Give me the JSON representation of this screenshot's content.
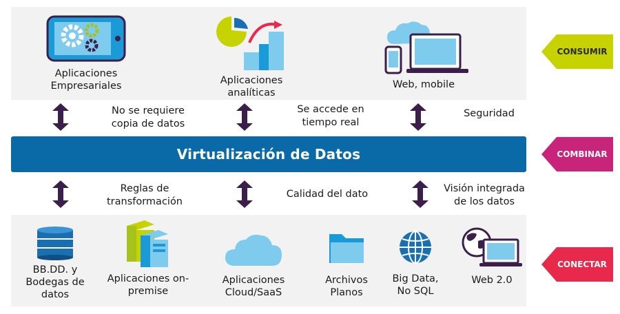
{
  "consumer_apps": [
    {
      "label": "Aplicaciones\nEmpresariales",
      "icon": "tablet-gears-icon"
    },
    {
      "label": "Aplicaciones\nanalíticas",
      "icon": "analytics-chart-icon"
    },
    {
      "label": "Web, mobile",
      "icon": "cloud-devices-icon"
    }
  ],
  "top_notes": [
    "No se requiere\ncopia de datos",
    "Se accede en\ntiempo real",
    "Seguridad"
  ],
  "center_band": "Virtualización de Datos",
  "bottom_notes": [
    "Reglas de\ntransformación",
    "Calidad del dato",
    "Visión integrada\nde los datos"
  ],
  "sources": [
    {
      "label": "BB.DD. y\nBodegas de\ndatos",
      "icon": "database-icon"
    },
    {
      "label": "Aplicaciones on-\npremise",
      "icon": "servers-icon"
    },
    {
      "label": "Aplicaciones\nCloud/SaaS",
      "icon": "cloud-icon"
    },
    {
      "label": "Archivos\nPlanos",
      "icon": "folder-icon"
    },
    {
      "label": "Big Data,\nNo SQL",
      "icon": "globe-icon"
    },
    {
      "label": "Web 2.0",
      "icon": "web-laptop-icon"
    }
  ],
  "tags": [
    {
      "label": "CONSUMIR",
      "color": "#c6d300"
    },
    {
      "label": "COMBINAR",
      "color": "#c7247a"
    },
    {
      "label": "CONECTAR",
      "color": "#e8294b"
    }
  ],
  "colors": {
    "band": "#0a6aa8",
    "arrow": "#3b1f4a",
    "panel": "#f2f2f2",
    "icon_light": "#7fcbee",
    "icon_blue": "#1a9ad6"
  }
}
